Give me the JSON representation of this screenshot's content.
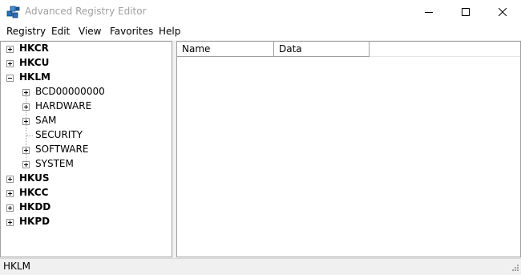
{
  "window": {
    "title": "Advanced Registry Editor"
  },
  "menu": [
    "Registry",
    "Edit",
    "View",
    "Favorites",
    "Help"
  ],
  "tree": {
    "roots": [
      {
        "label": "HKCR",
        "expanded": false
      },
      {
        "label": "HKCU",
        "expanded": false
      },
      {
        "label": "HKLM",
        "expanded": true,
        "selected": true,
        "children": [
          {
            "label": "BCD00000000",
            "has_children": true
          },
          {
            "label": "HARDWARE",
            "has_children": true
          },
          {
            "label": "SAM",
            "has_children": true
          },
          {
            "label": "SECURITY",
            "has_children": false
          },
          {
            "label": "SOFTWARE",
            "has_children": true
          },
          {
            "label": "SYSTEM",
            "has_children": true
          }
        ]
      },
      {
        "label": "HKUS",
        "expanded": false
      },
      {
        "label": "HKCC",
        "expanded": false
      },
      {
        "label": "HKDD",
        "expanded": false
      },
      {
        "label": "HKPD",
        "expanded": false
      }
    ]
  },
  "list": {
    "columns": [
      "Name",
      "Data"
    ],
    "rows": []
  },
  "status": {
    "text": "HKLM"
  },
  "icons": {
    "app": "registry-cubes-icon",
    "minimize": "minimize-icon",
    "maximize": "maximize-icon",
    "close": "close-icon",
    "grip": "resize-grip-icon"
  }
}
